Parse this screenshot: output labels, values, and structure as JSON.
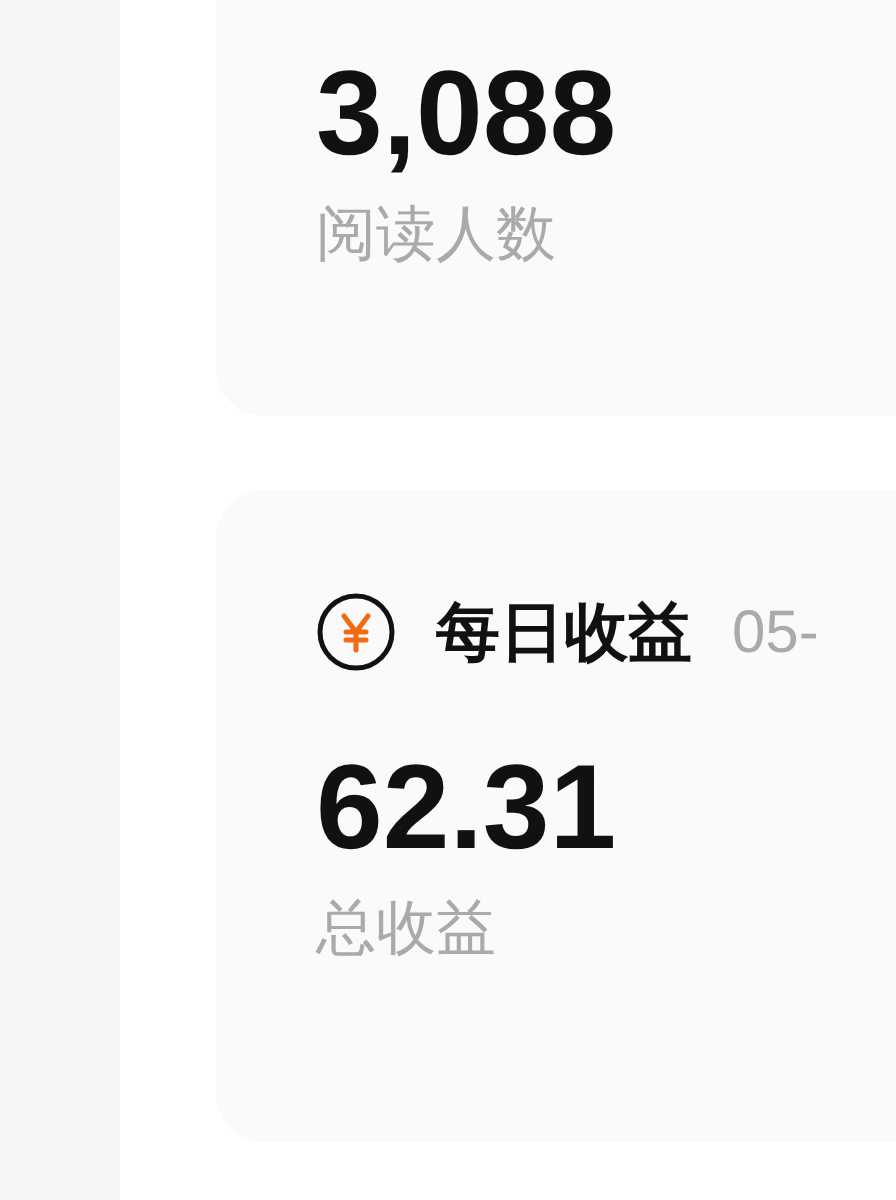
{
  "cards": [
    {
      "kind": "stat",
      "value": "3,088",
      "label": "阅读人数"
    },
    {
      "kind": "earnings",
      "title": "每日收益",
      "date": "05-",
      "value": "62.31",
      "label": "总收益"
    }
  ]
}
